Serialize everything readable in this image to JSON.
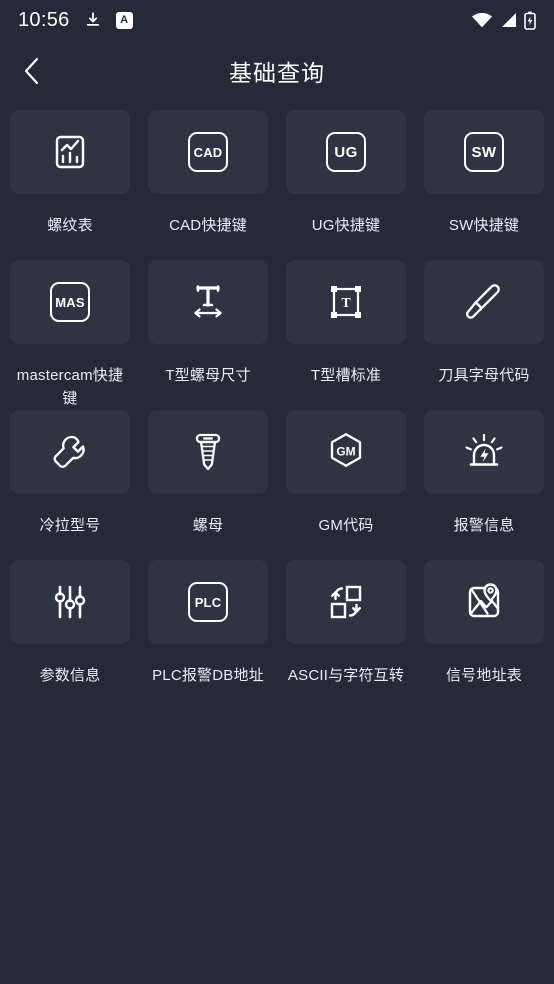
{
  "theme": {
    "bg": "#242a38",
    "tile_bg": "#2f3443",
    "text": "#e9ecf2",
    "icon": "#ffffff"
  },
  "statusbar": {
    "time": "10:56",
    "left_icons": [
      {
        "name": "download-icon",
        "glyph": "download"
      },
      {
        "name": "input-method-a-icon",
        "label": "A"
      }
    ],
    "right_icons": [
      {
        "name": "wifi-icon"
      },
      {
        "name": "cellular-signal-icon"
      },
      {
        "name": "battery-charging-icon"
      }
    ]
  },
  "header": {
    "back_label": "‹",
    "title": "基础查询"
  },
  "grid": {
    "items": [
      {
        "id": "thread-table",
        "label": "螺纹表",
        "icon": "chart-box-icon"
      },
      {
        "id": "cad-shortcuts",
        "label": "CAD快捷键",
        "icon": "cad-badge-icon",
        "badge": "CAD"
      },
      {
        "id": "ug-shortcuts",
        "label": "UG快捷键",
        "icon": "ug-badge-icon",
        "badge": "UG"
      },
      {
        "id": "sw-shortcuts",
        "label": "SW快捷键",
        "icon": "sw-badge-icon",
        "badge": "SW"
      },
      {
        "id": "mastercam-shortcuts",
        "label": "mastercam快捷键",
        "icon": "mas-badge-icon",
        "badge": "MAS"
      },
      {
        "id": "t-nut-size",
        "label": "T型螺母尺寸",
        "icon": "t-width-arrow-icon"
      },
      {
        "id": "t-slot-standard",
        "label": "T型槽标准",
        "icon": "t-bounding-box-icon"
      },
      {
        "id": "tool-letter-codes",
        "label": "刀具字母代码",
        "icon": "knife-icon"
      },
      {
        "id": "cold-drawn-models",
        "label": "冷拉型号",
        "icon": "wrench-icon"
      },
      {
        "id": "nuts",
        "label": "螺母",
        "icon": "screw-icon"
      },
      {
        "id": "gm-codes",
        "label": "GM代码",
        "icon": "gm-hexagon-icon",
        "badge": "GM"
      },
      {
        "id": "alarm-info",
        "label": "报警信息",
        "icon": "alarm-light-icon"
      },
      {
        "id": "parameter-info",
        "label": "参数信息",
        "icon": "sliders-icon"
      },
      {
        "id": "plc-alarm-db",
        "label": "PLC报警DB地址",
        "icon": "plc-badge-icon",
        "badge": "PLC"
      },
      {
        "id": "ascii-converter",
        "label": "ASCII与字符互转",
        "icon": "swap-squares-icon"
      },
      {
        "id": "signal-address",
        "label": "信号地址表",
        "icon": "map-pin-icon"
      }
    ]
  }
}
